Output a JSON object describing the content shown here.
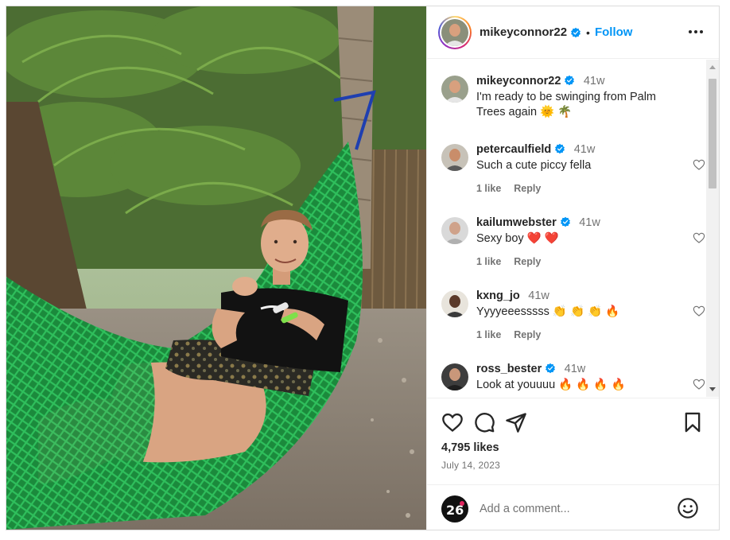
{
  "post": {
    "username": "mikeyconnor22",
    "follow_label": "Follow",
    "dot": "•",
    "caption": {
      "username": "mikeyconnor22",
      "time": "41w",
      "text": "I'm ready to be swinging from Palm Trees again 🌞 🌴"
    },
    "comments": [
      {
        "username": "petercaulfield",
        "verified": true,
        "time": "41w",
        "text": "Such a cute piccy fella",
        "likes": "1 like",
        "reply": "Reply"
      },
      {
        "username": "kailumwebster",
        "verified": true,
        "time": "41w",
        "text": "Sexy boy ❤️ ❤️",
        "likes": "1 like",
        "reply": "Reply"
      },
      {
        "username": "kxng_jo",
        "verified": false,
        "time": "41w",
        "text": "Yyyyeeesssss 👏 👏 👏 🔥",
        "likes": "1 like",
        "reply": "Reply"
      },
      {
        "username": "ross_bester",
        "verified": true,
        "time": "41w",
        "text": "Look at youuuu 🔥 🔥 🔥 🔥",
        "likes": "",
        "reply": ""
      }
    ],
    "likes": "4,795 likes",
    "date": "July 14, 2023",
    "add_comment_placeholder": "Add a comment...",
    "icons": {
      "like": "heart-icon",
      "comment": "comment-icon",
      "share": "share-icon",
      "save": "bookmark-icon",
      "more": "more-options-icon",
      "emoji": "emoji-icon",
      "verified": "verified-badge-icon"
    },
    "colors": {
      "accent": "#0095f6",
      "text": "#262626",
      "muted": "#737373",
      "hammock": "#1f9e44"
    }
  }
}
